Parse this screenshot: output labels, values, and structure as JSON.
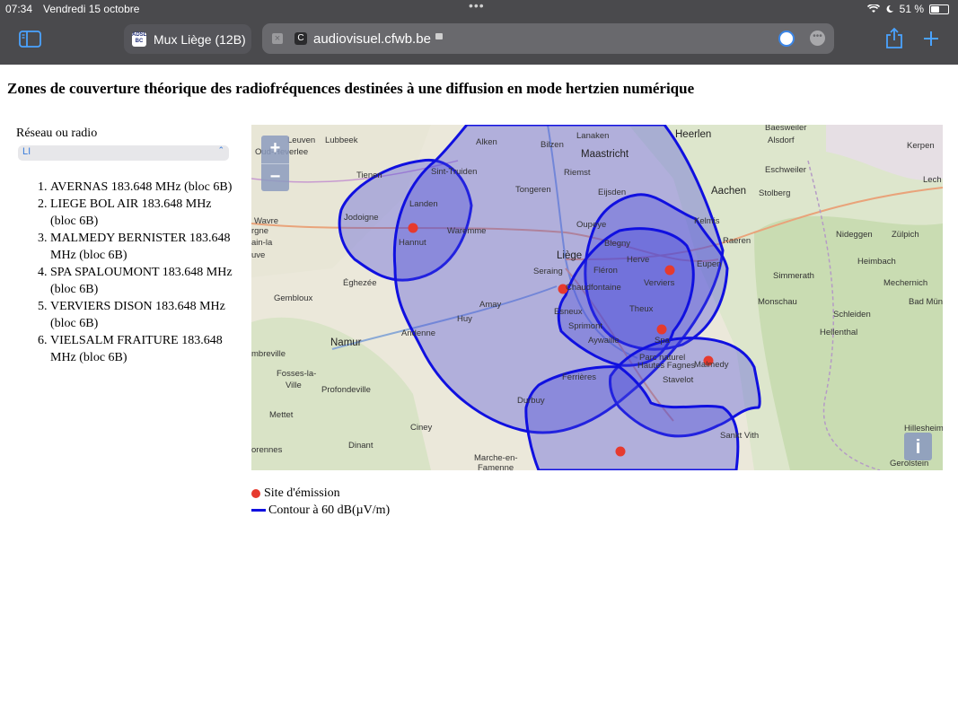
{
  "status_bar": {
    "time": "07:34",
    "date": "Vendredi 15 octobre",
    "battery": "51 %",
    "battery_level": 0.51
  },
  "browser": {
    "tab_title": "Mux Liège (12B)",
    "tab_favicon_text": "ADSL BC",
    "url": "audiovisuel.cfwb.be",
    "reader_icon_label": "C"
  },
  "page": {
    "title": "Zones de couverture théorique des radiofréquences destinées à une diffusion en mode hertzien numérique",
    "select_label": "Réseau ou radio",
    "select_value": "LI",
    "sites": [
      "AVERNAS 183.648 MHz (bloc 6B)",
      "LIEGE BOL AIR 183.648 MHz (bloc 6B)",
      "MALMEDY BERNISTER 183.648 MHz (bloc 6B)",
      "SPA SPALOUMONT 183.648 MHz (bloc 6B)",
      "VERVIERS DISON 183.648 MHz (bloc 6B)",
      "VIELSALM FRAITURE 183.648 MHz (bloc 6B)"
    ]
  },
  "map": {
    "zoom_in": "+",
    "zoom_out": "−",
    "info": "i",
    "coverage_color": "#1010e0",
    "site_color": "#e63a2e",
    "places": {
      "leuven": "Leuven",
      "lubbeek": "Lubbeek",
      "alken": "Alken",
      "bilzen": "Bilzen",
      "lanaken": "Lanaken",
      "heerlen": "Heerlen",
      "baesweiler": "Baesweiler",
      "alsdorf": "Alsdorf",
      "kerpen": "Kerpen",
      "oud_heverlee": "Oud-Heverlee",
      "sint_truiden": "Sint-Truiden",
      "riemst": "Riemst",
      "maastricht": "Maastricht",
      "eschweiler": "Eschweiler",
      "tienen": "Tienen",
      "tongeren": "Tongeren",
      "eijsden": "Eijsden",
      "aachen": "Aachen",
      "stolberg": "Stolberg",
      "lech": "Lech",
      "landen": "Landen",
      "jodoigne": "Jodoigne",
      "oupeye": "Oupeye",
      "kelmis": "Kelmis",
      "wavre": "Wavre",
      "waremme": "Waremme",
      "hannut": "Hannut",
      "blegny": "Blegny",
      "nideggen": "Nideggen",
      "zulpich": "Zülpich",
      "liege": "Liège",
      "raeren": "Raeren",
      "heimbach": "Heimbach",
      "seraing": "Seraing",
      "herve": "Herve",
      "eupen": "Eupen",
      "fleron": "Fléron",
      "simmerath": "Simmerath",
      "gembloux": "Gembloux",
      "eghezee": "Éghezée",
      "chaudfontaine": "Chaudfontaine",
      "verviers": "Verviers",
      "mechernich": "Mechernich",
      "amay": "Amay",
      "esneux": "Esneux",
      "theux": "Theux",
      "monschau": "Monschau",
      "bad_mun": "Bad Mün",
      "huy": "Huy",
      "sprimont": "Sprimont",
      "schleiden": "Schleiden",
      "namur": "Namur",
      "andenne": "Andenne",
      "aywaille": "Aywaille",
      "spa": "Spa",
      "hellenthal": "Hellenthal",
      "sambreville": "mbreville",
      "malmedy": "Malmedy",
      "fosses": "Fosses-la-",
      "ville": "Ville",
      "profondeville": "Profondeville",
      "ferrieres": "Ferrières",
      "stavelot": "Stavelot",
      "durbuy": "Durbuy",
      "mettet": "Mettet",
      "ciney": "Ciney",
      "sankt_vith": "Sankt Vith",
      "hillesheim": "Hillesheim",
      "dinant": "Dinant",
      "florennes": "orennes",
      "gerolstein": "Gerolstein",
      "marche": "Marche-en-",
      "famenne": "Famenne",
      "parc": "Parc naturel",
      "hautes_fagnes": "Hautes Fagnes",
      "wavre_left": "Wavre",
      "geraine": "rgne",
      "ain_la": "ain-la",
      "euve": "uve"
    }
  },
  "legend": {
    "site": "Site d'émission",
    "contour": "Contour à 60 dB(µV/m)"
  }
}
